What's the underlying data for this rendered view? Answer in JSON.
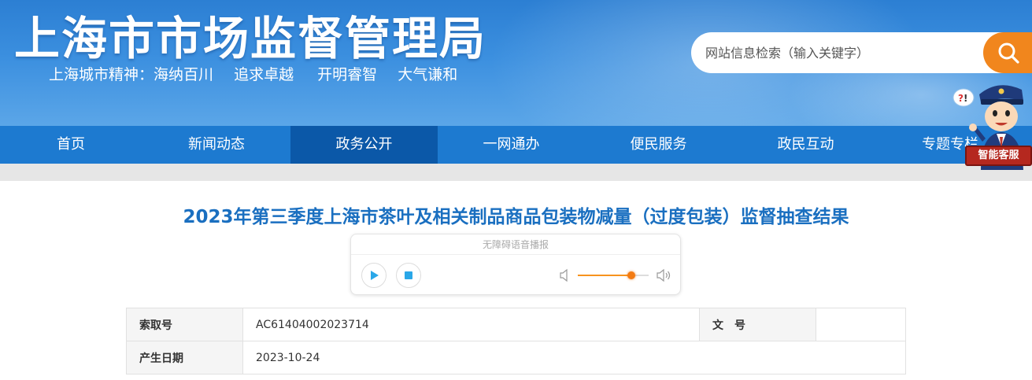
{
  "header": {
    "site_title": "上海市市场监督管理局",
    "slogan": [
      "上海城市精神：海纳百川",
      "追求卓越",
      "开明睿智",
      "大气谦和"
    ],
    "search": {
      "placeholder": "网站信息检索（输入关键字）",
      "button_icon": "search-icon"
    },
    "service": {
      "label": "智能客服",
      "icon": "service-mascot-icon"
    }
  },
  "nav": {
    "items": [
      {
        "label": "首页",
        "active": false
      },
      {
        "label": "新闻动态",
        "active": false
      },
      {
        "label": "政务公开",
        "active": true
      },
      {
        "label": "一网通办",
        "active": false
      },
      {
        "label": "便民服务",
        "active": false
      },
      {
        "label": "政民互动",
        "active": false
      },
      {
        "label": "专题专栏",
        "active": false
      }
    ]
  },
  "article": {
    "title": "2023年第三季度上海市茶叶及相关制品商品包装物减量（过度包装）监督抽查结果",
    "player": {
      "caption": "无障碍语音播报",
      "volume": 0.75
    },
    "meta": [
      {
        "label": "索取号",
        "value": "AC61404002023714",
        "label2": "文　号",
        "value2": ""
      },
      {
        "label": "产生日期",
        "value": "2023-10-24"
      }
    ]
  },
  "colors": {
    "nav_bg": "#1d7ad0",
    "nav_active": "#0b58a8",
    "title": "#1a6fc0",
    "search_button": "#f1861d",
    "player_accent": "#2aa7e8"
  }
}
